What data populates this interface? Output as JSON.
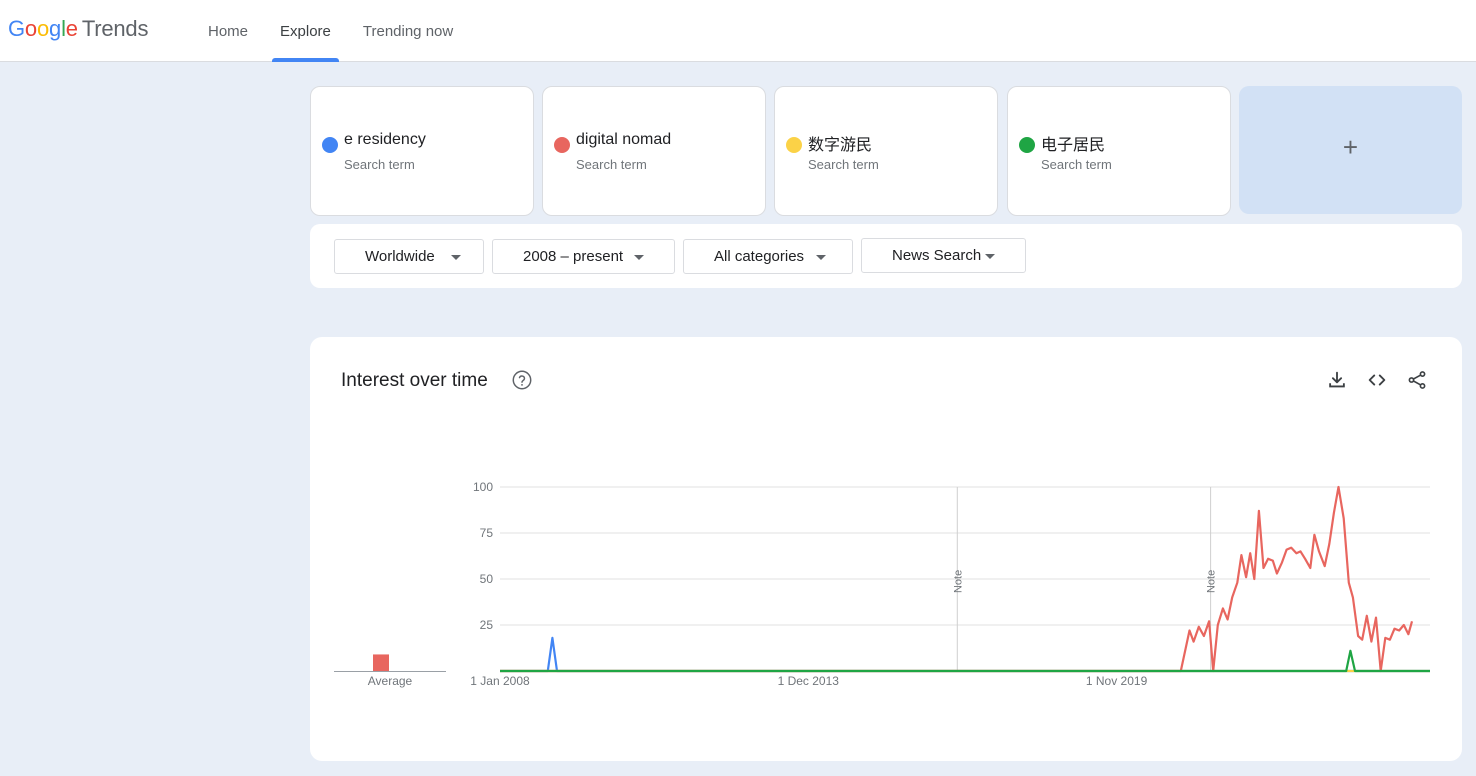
{
  "header": {
    "logo_letters": [
      "G",
      "o",
      "o",
      "g",
      "l",
      "e"
    ],
    "logo_suffix": "Trends",
    "nav": [
      "Home",
      "Explore",
      "Trending now"
    ]
  },
  "terms": [
    {
      "name": "e residency",
      "sub": "Search term",
      "color": "#4285f4"
    },
    {
      "name": "digital nomad",
      "sub": "Search term",
      "color": "#e8665f"
    },
    {
      "name": "数字游民",
      "sub": "Search term",
      "color": "#fbd247"
    },
    {
      "name": "电子居民",
      "sub": "Search term",
      "color": "#1fa544"
    }
  ],
  "add_label": "+",
  "filters": {
    "region": "Worldwide",
    "time": "2008 – present",
    "category": "All categories",
    "property": "News Search"
  },
  "iot": {
    "title": "Interest over time",
    "icons": [
      "help-icon",
      "download-icon",
      "embed-icon",
      "share-icon"
    ]
  },
  "chart_data": {
    "type": "line",
    "x_labels": [
      "1 Jan 2008",
      "1 Dec 2013",
      "1 Nov 2019"
    ],
    "x_range": [
      2008.0,
      2026.1
    ],
    "ylim": [
      0,
      100
    ],
    "yticks": [
      25,
      50,
      75,
      100
    ],
    "notes": [
      {
        "x": 2016.9,
        "text": "Note"
      },
      {
        "x": 2021.83,
        "text": "Note"
      }
    ],
    "average_label": "Average",
    "averages": [
      {
        "series": "digital nomad",
        "value": 9
      }
    ],
    "series": [
      {
        "name": "e residency",
        "color": "#4285f4",
        "points": [
          [
            2008.0,
            0
          ],
          [
            2008.93,
            0
          ],
          [
            2009.02,
            18
          ],
          [
            2009.11,
            0
          ],
          [
            2026.1,
            0
          ]
        ]
      },
      {
        "name": "数字游民",
        "color": "#fbd247",
        "points": [
          [
            2008.0,
            0
          ],
          [
            2026.1,
            0
          ]
        ]
      },
      {
        "name": "digital nomad",
        "color": "#e8665f",
        "points": [
          [
            2008.0,
            0
          ],
          [
            2021.25,
            0
          ],
          [
            2021.42,
            22
          ],
          [
            2021.5,
            16
          ],
          [
            2021.6,
            24
          ],
          [
            2021.7,
            19
          ],
          [
            2021.8,
            27
          ],
          [
            2021.88,
            0
          ],
          [
            2021.97,
            25
          ],
          [
            2022.07,
            34
          ],
          [
            2022.16,
            28
          ],
          [
            2022.25,
            40
          ],
          [
            2022.35,
            48
          ],
          [
            2022.43,
            63
          ],
          [
            2022.52,
            51
          ],
          [
            2022.6,
            64
          ],
          [
            2022.68,
            50
          ],
          [
            2022.77,
            87
          ],
          [
            2022.86,
            56
          ],
          [
            2022.95,
            61
          ],
          [
            2023.04,
            60
          ],
          [
            2023.12,
            53
          ],
          [
            2023.22,
            59
          ],
          [
            2023.31,
            66
          ],
          [
            2023.4,
            67
          ],
          [
            2023.5,
            64
          ],
          [
            2023.58,
            65
          ],
          [
            2023.67,
            61
          ],
          [
            2023.77,
            56
          ],
          [
            2023.85,
            74
          ],
          [
            2023.94,
            65
          ],
          [
            2024.05,
            57
          ],
          [
            2024.14,
            69
          ],
          [
            2024.23,
            86
          ],
          [
            2024.32,
            100
          ],
          [
            2024.42,
            83
          ],
          [
            2024.52,
            48
          ],
          [
            2024.6,
            40
          ],
          [
            2024.7,
            19
          ],
          [
            2024.78,
            17
          ],
          [
            2024.87,
            30
          ],
          [
            2024.96,
            16
          ],
          [
            2025.05,
            29
          ],
          [
            2025.14,
            0
          ],
          [
            2025.23,
            18
          ],
          [
            2025.32,
            17
          ],
          [
            2025.41,
            23
          ],
          [
            2025.5,
            22
          ],
          [
            2025.59,
            25
          ],
          [
            2025.68,
            20
          ],
          [
            2025.75,
            27
          ]
        ]
      },
      {
        "name": "电子居民",
        "color": "#1fa544",
        "points": [
          [
            2008.0,
            0
          ],
          [
            2024.47,
            0
          ],
          [
            2024.55,
            11
          ],
          [
            2024.64,
            0
          ],
          [
            2026.1,
            0
          ]
        ]
      }
    ]
  }
}
